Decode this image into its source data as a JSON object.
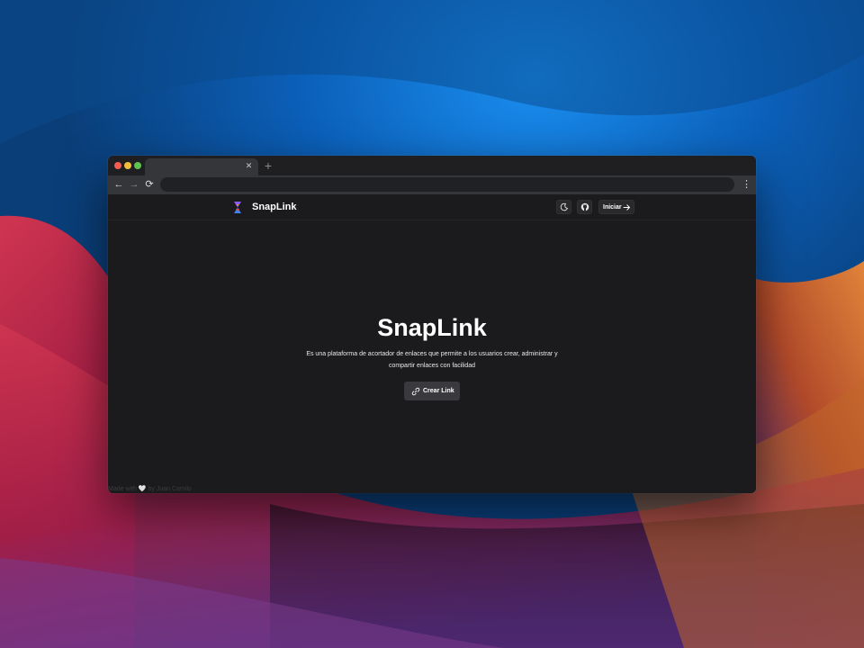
{
  "desktop": {
    "colors": {
      "sky": "#0b3f78",
      "accent_blue": "#0a6ad0",
      "red": "#c42d4a",
      "orange": "#d8782c",
      "purple": "#7a3a8a"
    }
  },
  "browser": {
    "tab": {
      "close_icon": "close-icon",
      "close_glyph": "✕"
    },
    "new_tab_glyph": "+",
    "back_glyph": "←",
    "forward_glyph": "→",
    "reload_glyph": "⟳",
    "menu_glyph": "⋮",
    "address": ""
  },
  "site": {
    "brand": "SnapLink",
    "header": {
      "theme_icon": "moon-icon",
      "github_icon": "github-icon",
      "login_label": "Iniciar",
      "login_icon": "arrow-right-icon"
    },
    "hero": {
      "title": "SnapLink",
      "description": "Es una plataforma de acortador de enlaces que permite a los usuarios crear, administrar y compartir enlaces con facilidad",
      "cta_label": "Crear Link",
      "cta_icon": "link-icon"
    },
    "footer": {
      "made_with": "Made with",
      "heart": "🤍",
      "by": "by Juan Camilo"
    },
    "colors": {
      "background": "#1b1b1d",
      "button": "#3a3a3e",
      "text": "#ffffff"
    }
  }
}
